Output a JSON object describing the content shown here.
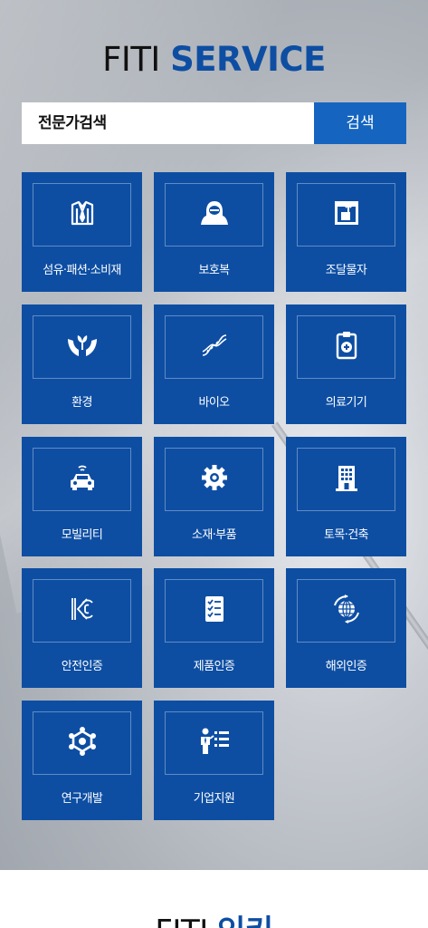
{
  "header": {
    "title_part1": "FITI",
    "title_part2": "SERVICE"
  },
  "search": {
    "value": "전문가검색",
    "button_label": "검색"
  },
  "colors": {
    "tile_bg": "#0d4ea3",
    "search_button": "#1565c0",
    "accent": "#0d4ea3"
  },
  "tiles": [
    {
      "label": "섬유·패션·소비재",
      "icon": "shirt-icon"
    },
    {
      "label": "보호복",
      "icon": "hazmat-suit-icon"
    },
    {
      "label": "조달물자",
      "icon": "procurement-box-icon"
    },
    {
      "label": "환경",
      "icon": "hands-sprout-icon"
    },
    {
      "label": "바이오",
      "icon": "dna-icon"
    },
    {
      "label": "의료기기",
      "icon": "medical-clipboard-icon"
    },
    {
      "label": "모빌리티",
      "icon": "connected-car-icon"
    },
    {
      "label": "소재·부품",
      "icon": "gear-icon"
    },
    {
      "label": "토목·건축",
      "icon": "building-icon"
    },
    {
      "label": "안전인증",
      "icon": "kc-mark-icon"
    },
    {
      "label": "제품인증",
      "icon": "checklist-icon"
    },
    {
      "label": "해외인증",
      "icon": "globe-icon"
    },
    {
      "label": "연구개발",
      "icon": "research-network-icon"
    },
    {
      "label": "기업지원",
      "icon": "presenter-icon"
    }
  ],
  "next_section": {
    "title_part1": "FITI",
    "title_part2": "인키"
  }
}
